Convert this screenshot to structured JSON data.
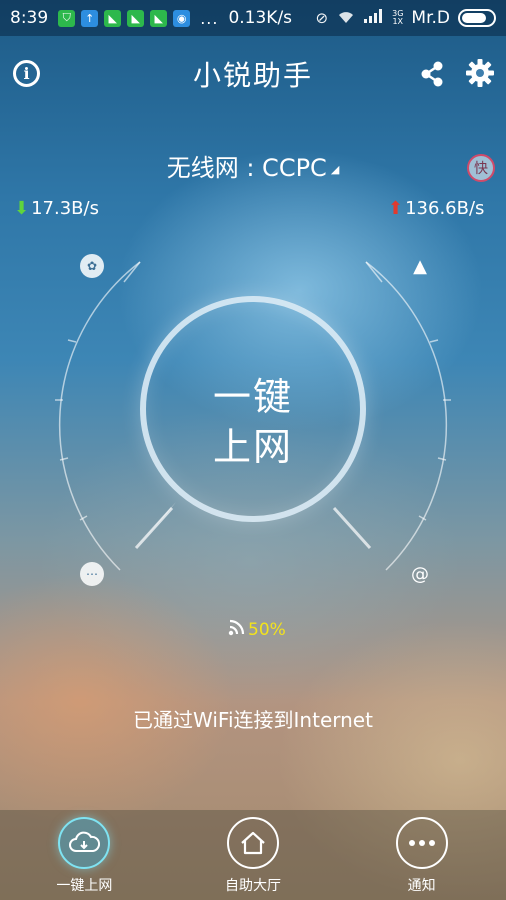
{
  "status_bar": {
    "time": "8:39",
    "overflow": "...",
    "net_speed": "0.13K/s",
    "net_type_top": "3G",
    "net_type_bottom": "1X",
    "carrier": "Mr.D"
  },
  "header": {
    "title": "小锐助手"
  },
  "network": {
    "label": "无线网 : CCPC",
    "fast_badge": "快"
  },
  "speeds": {
    "download": "17.3B/s",
    "upload": "136.6B/s"
  },
  "dial": {
    "button_line1": "一键",
    "button_line2": "上网"
  },
  "signal": {
    "strength": "50%"
  },
  "status_message": "已通过WiFi连接到Internet",
  "nav": {
    "items": [
      {
        "label": "一键上网",
        "icon": "cloud-icon",
        "active": true
      },
      {
        "label": "自助大厅",
        "icon": "home-icon",
        "active": false
      },
      {
        "label": "通知",
        "icon": "more-icon",
        "active": false
      }
    ]
  },
  "colors": {
    "download_arrow": "#5fd53c",
    "upload_arrow": "#e23a2e",
    "signal_text": "#f3e31c",
    "active_nav": "#7fe3f2"
  }
}
